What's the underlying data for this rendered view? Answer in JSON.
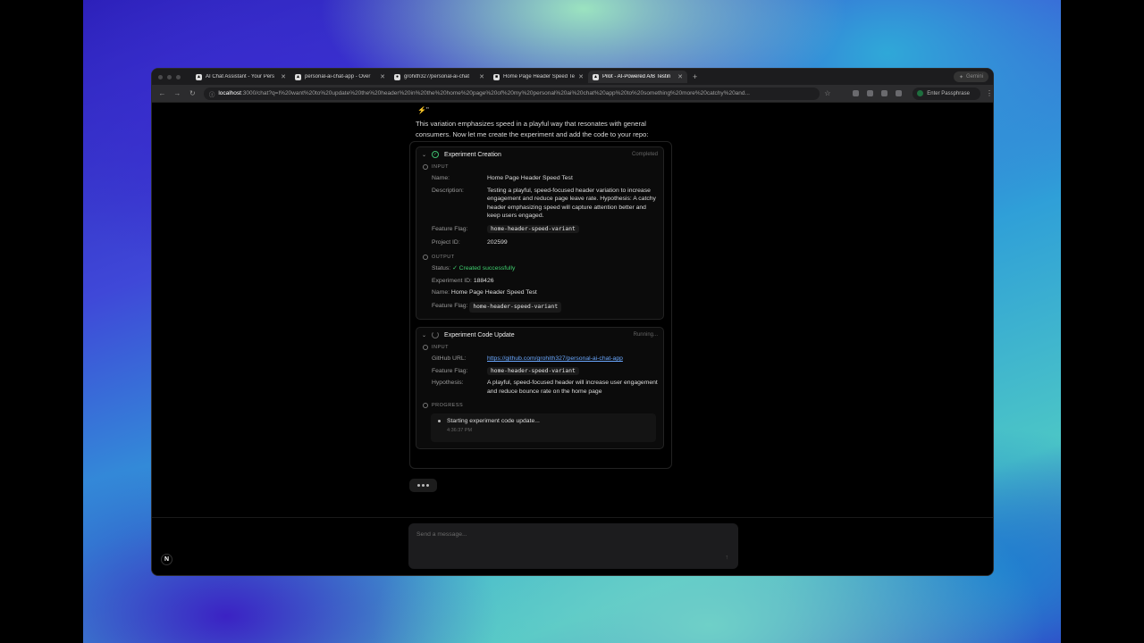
{
  "browser": {
    "tabs": [
      {
        "label": "AI Chat Assistant - Your Pers",
        "active": false
      },
      {
        "label": "personal-ai-chat-app - Over",
        "active": false
      },
      {
        "label": "grohith327/personal-ai-chat",
        "active": false
      },
      {
        "label": "Home Page Header Speed Te",
        "active": false
      },
      {
        "label": "Pilot - AI-Powered A/B Testin",
        "active": true
      }
    ],
    "new_tab": "+",
    "gemini_label": "Gemini",
    "url_host": "localhost",
    "url_rest": ":3000/chat?q=I%20want%20to%20update%20the%20header%20in%20the%20home%20page%20of%20my%20personal%20ai%20chat%20app%20to%20something%20more%20catchy%20and...",
    "passphrase_label": "Enter Passphrase"
  },
  "chat": {
    "sparkle": "⚡\"",
    "intro": "This variation emphasizes speed in a playful way that resonates with general consumers. Now let me create the experiment and add the code to your repo:",
    "experiment_creation": {
      "title": "Experiment Creation",
      "status": "Completed",
      "input_label": "INPUT",
      "fields": {
        "name_key": "Name:",
        "name_val": "Home Page Header Speed Test",
        "desc_key": "Description:",
        "desc_val": "Testing a playful, speed-focused header variation to increase engagement and reduce page leave rate. Hypothesis: A catchy header emphasizing speed will capture attention better and keep users engaged.",
        "flag_key": "Feature Flag:",
        "flag_val": "home-header-speed-variant",
        "project_key": "Project ID:",
        "project_val": "202599"
      },
      "output_label": "OUTPUT",
      "output": {
        "status_key": "Status:",
        "status_val": "✓ Created successfully",
        "exp_id_key": "Experiment ID:",
        "exp_id_val": "188426",
        "name_key": "Name:",
        "name_val": "Home Page Header Speed Test",
        "flag_key": "Feature Flag:",
        "flag_val": "home-header-speed-variant"
      }
    },
    "code_update": {
      "title": "Experiment Code Update",
      "status": "Running...",
      "input_label": "INPUT",
      "fields": {
        "github_key": "GitHub URL:",
        "github_val": "https://github.com/grohith327/personal-ai-chat-app",
        "flag_key": "Feature Flag:",
        "flag_val": "home-header-speed-variant",
        "hyp_key": "Hypothesis:",
        "hyp_val": "A playful, speed-focused header will increase user engagement and reduce bounce rate on the home page"
      },
      "progress_label": "PROGRESS",
      "progress_text": "Starting experiment code update...",
      "progress_time": "4:36:37 PM"
    },
    "composer_placeholder": "Send a message...",
    "send_icon": "↑",
    "logo": "N"
  }
}
